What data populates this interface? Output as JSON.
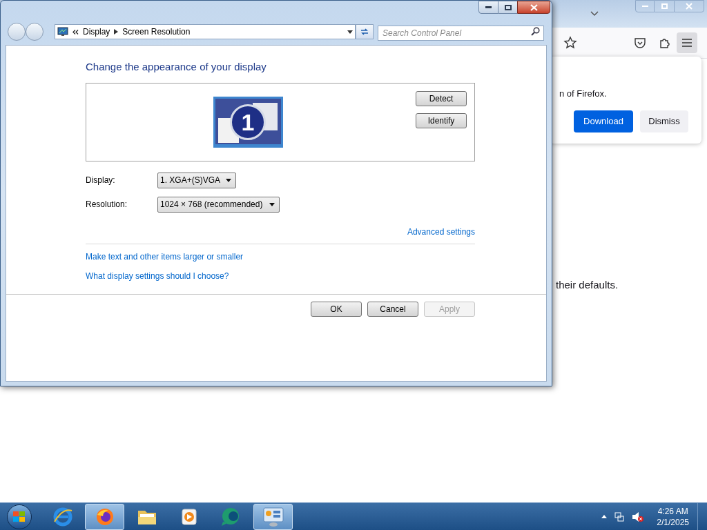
{
  "control_panel": {
    "breadcrumb": [
      "Display",
      "Screen Resolution"
    ],
    "search": {
      "placeholder": "Search Control Panel"
    },
    "heading": "Change the appearance of your display",
    "monitor_number": "1",
    "side_buttons": [
      "Detect",
      "Identify"
    ],
    "fields": [
      {
        "label": "Display:",
        "value": "1. XGA+(S)VGA"
      },
      {
        "label": "Resolution:",
        "value": "1024 × 768 (recommended)"
      }
    ],
    "advanced_link": "Advanced settings",
    "links": [
      "Make text and other items larger or smaller",
      "What display settings should I choose?"
    ],
    "buttons": [
      {
        "label": "OK",
        "disabled": false
      },
      {
        "label": "Cancel",
        "disabled": false
      },
      {
        "label": "Apply",
        "disabled": true
      }
    ]
  },
  "browser": {
    "notice_text": "n of Firefox.",
    "buttons": [
      {
        "label": "Download",
        "kind": "primary"
      },
      {
        "label": "Dismiss",
        "kind": "secondary"
      }
    ],
    "page_text": "their defaults."
  },
  "taskbar": {
    "apps": [
      {
        "kind": "ie",
        "highlighted": false
      },
      {
        "kind": "firefox",
        "highlighted": true
      },
      {
        "kind": "explorer",
        "highlighted": false
      },
      {
        "kind": "media",
        "highlighted": false
      },
      {
        "kind": "messenger",
        "highlighted": false
      },
      {
        "kind": "control",
        "highlighted": true
      }
    ],
    "clock": {
      "time": "4:26 AM",
      "date": "2/1/2025"
    }
  }
}
